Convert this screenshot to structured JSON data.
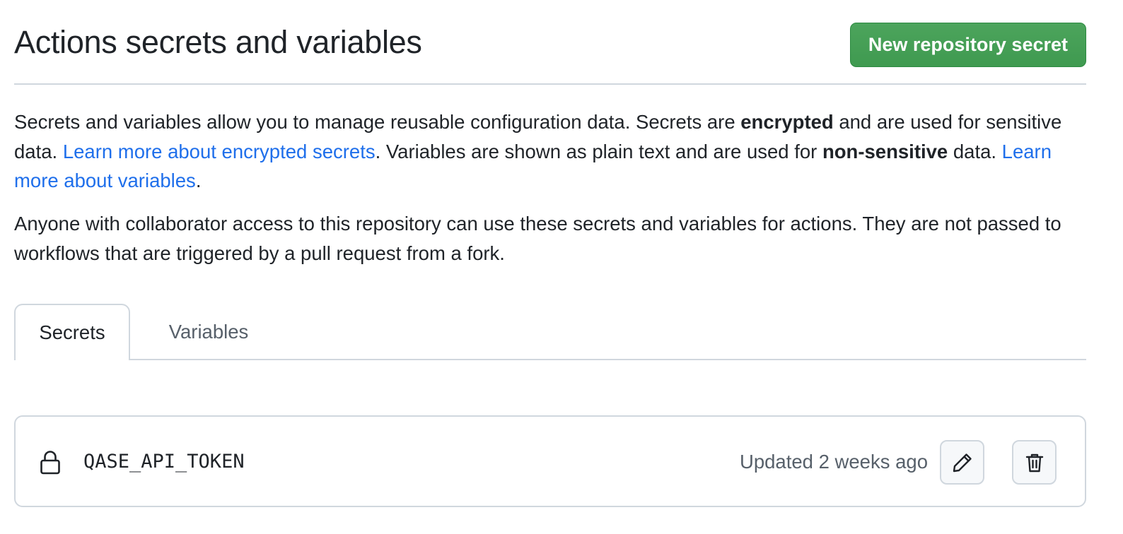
{
  "header": {
    "title": "Actions secrets and variables",
    "new_secret_label": "New repository secret"
  },
  "description": {
    "p1_a": "Secrets and variables allow you to manage reusable configuration data. Secrets are ",
    "p1_bold_1": "encrypted",
    "p1_b": " and are used for sensitive data. ",
    "p1_link_1": "Learn more about encrypted secrets",
    "p1_c": ". Variables are shown as plain text and are used for ",
    "p1_bold_2": "non-sensitive",
    "p1_d": " data. ",
    "p1_link_2": "Learn more about variables",
    "p1_e": ".",
    "p2": "Anyone with collaborator access to this repository can use these secrets and variables for actions. They are not passed to workflows that are triggered by a pull request from a fork."
  },
  "tabs": [
    {
      "label": "Secrets",
      "selected": true
    },
    {
      "label": "Variables",
      "selected": false
    }
  ],
  "secrets": [
    {
      "name": "QASE_API_TOKEN",
      "updated": "Updated 2 weeks ago",
      "icon": "lock-icon",
      "actions": [
        "pencil-icon",
        "trash-icon"
      ]
    }
  ],
  "colors": {
    "primary_button": "#3f9a50",
    "link": "#1f6feb",
    "border": "#d0d7de",
    "muted_text": "#57606a"
  }
}
